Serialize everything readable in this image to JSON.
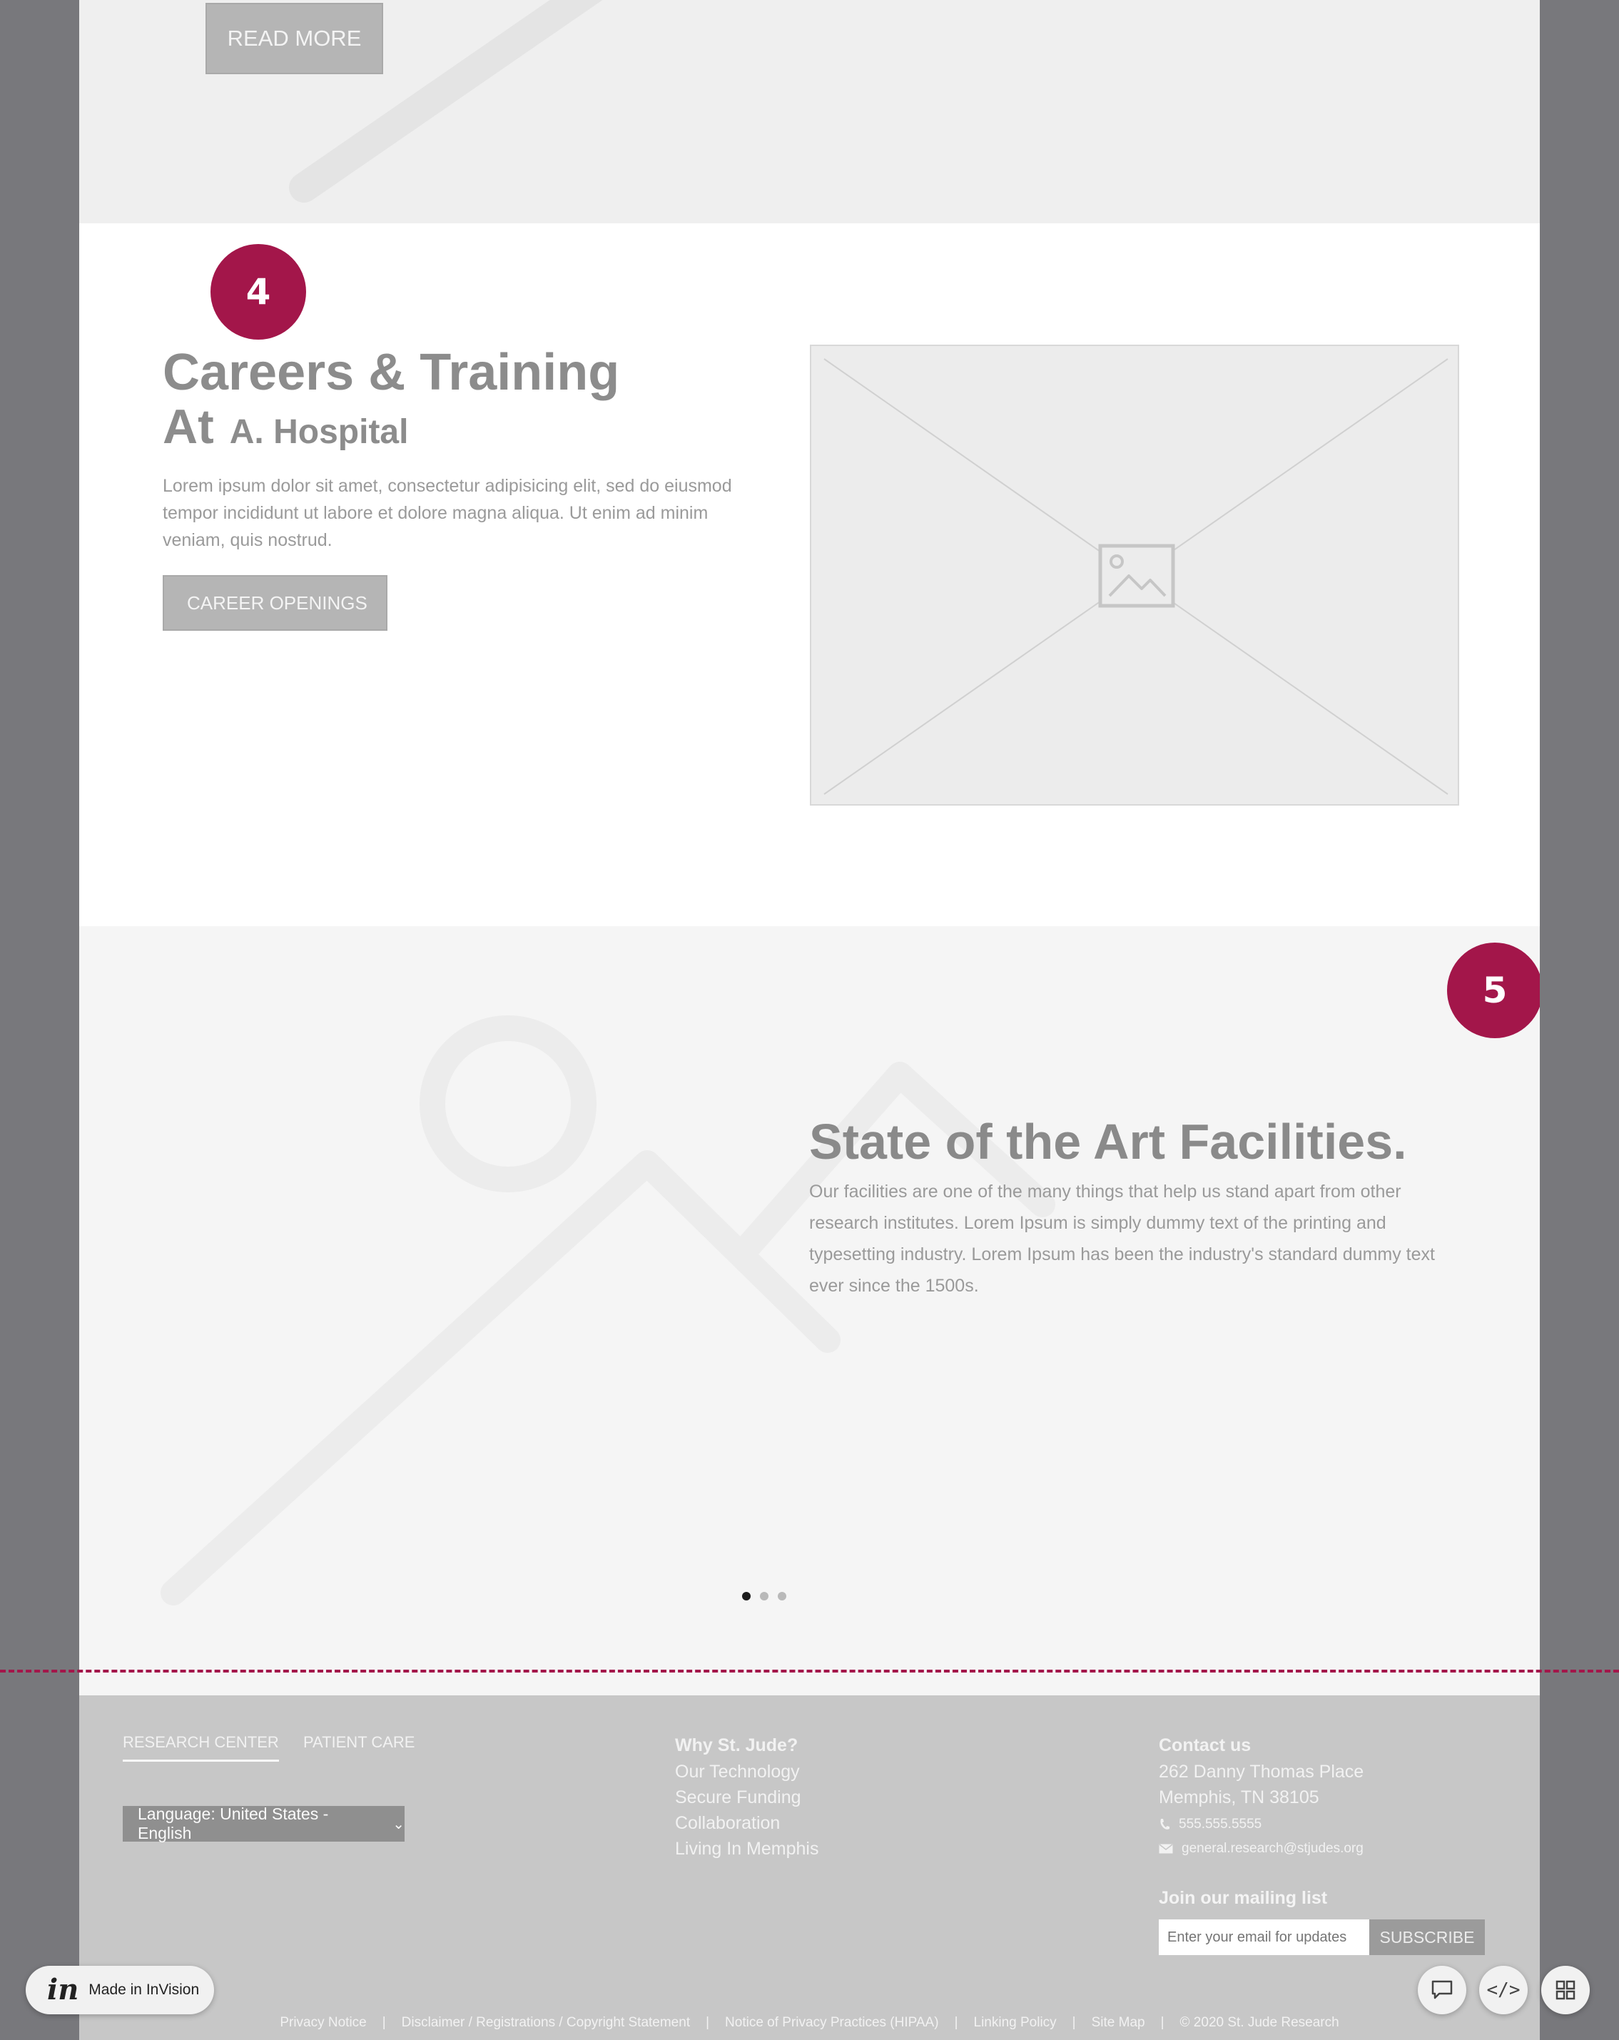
{
  "hero_top": {
    "read_more": "READ MORE"
  },
  "careers": {
    "badge": "4",
    "title": "Careers & Training",
    "subtitle_at": "At",
    "subtitle_hospital": "A. Hospital",
    "body": "Lorem ipsum dolor sit amet, consectetur adipisicing elit, sed do eiusmod tempor incididunt ut labore et dolore magna aliqua. Ut enim ad minim veniam, quis nostrud.",
    "button": "CAREER OPENINGS"
  },
  "facilities": {
    "badge": "5",
    "title": "State of the Art Facilities.",
    "body": "Our facilities are one of the many things that help us stand apart from other research institutes. Lorem Ipsum is simply dummy text of the printing and typesetting industry. Lorem Ipsum has been the industry's standard dummy text ever since the 1500s.",
    "carousel": {
      "slide_count": 3,
      "active_slide": 1
    }
  },
  "footer": {
    "tabs": [
      {
        "label": "RESEARCH CENTER",
        "active": true
      },
      {
        "label": "PATIENT CARE",
        "active": false
      }
    ],
    "language": "Language: United States - English",
    "why": {
      "heading": "Why St. Jude?",
      "links": [
        "Our Technology",
        "Secure Funding",
        "Collaboration",
        "Living In Memphis"
      ]
    },
    "contact": {
      "heading": "Contact us",
      "address1": "262 Danny Thomas Place",
      "address2": "Memphis, TN 38105",
      "phone": "555.555.5555",
      "email": "general.research@stjudes.org"
    },
    "mailing": {
      "heading": "Join our mailing list",
      "placeholder": "Enter your email for updates",
      "subscribe": "SUBSCRIBE"
    },
    "legal_links": [
      "Privacy Notice",
      "Disclaimer / Registrations / Copyright Statement",
      "Notice of Privacy Practices (HIPAA)",
      "Linking Policy",
      "Site Map"
    ],
    "copyright": "© 2020 St. Jude Research",
    "separator": "|"
  },
  "invision": {
    "logo": "in",
    "made_in": "Made in InVision",
    "code_icon": "</>",
    "icons": [
      "comment-icon",
      "code-icon",
      "grid-icon"
    ]
  },
  "colors": {
    "accent": "#a3164a",
    "backdrop": "#78787c",
    "footer_bg": "#c7c7c7",
    "button_gray": "#b5b5b5"
  }
}
